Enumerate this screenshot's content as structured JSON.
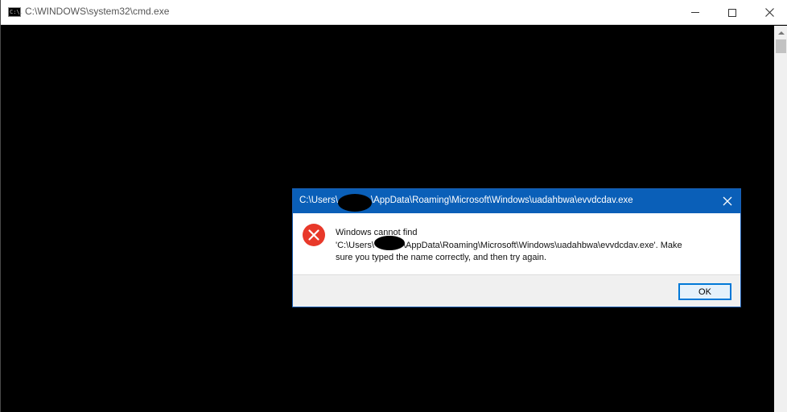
{
  "cmd_window": {
    "title": "C:\\WINDOWS\\system32\\cmd.exe",
    "icon_text": "C:\\."
  },
  "dialog": {
    "title": "C:\\Users\\[redacted]\\AppData\\Roaming\\Microsoft\\Windows\\uadahbwa\\evvdcdav.exe",
    "title_prefix": "C:\\Users\\",
    "title_suffix": "\\AppData\\Roaming\\Microsoft\\Windows\\uadahbwa\\evvdcdav.exe",
    "message_line1": "Windows cannot find",
    "message_line2_prefix": "'C:\\Users\\",
    "message_line2_suffix": "\\AppData\\Roaming\\Microsoft\\Windows\\uadahbwa\\evvdcdav.exe'. Make",
    "message_line3": "sure you typed the name correctly, and then try again.",
    "ok_label": "OK"
  },
  "colors": {
    "dialog_title_bg": "#0a5fb8",
    "error_icon": "#e8392a",
    "ok_border": "#0078d7"
  }
}
